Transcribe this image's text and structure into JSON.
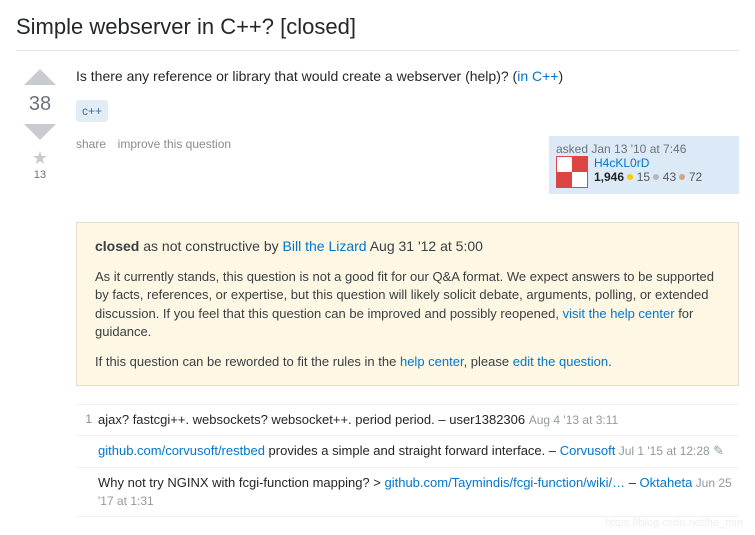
{
  "title": "Simple webserver in C++? [closed]",
  "body_pre": "Is there any reference or library that would create a webserver (help)? (",
  "body_link": "in C++",
  "body_post": ")",
  "tag": "c++",
  "votes": "38",
  "favorites": "13",
  "actions": {
    "share": "share",
    "improve": "improve this question"
  },
  "usercard": {
    "asked": "asked Jan 13 '10 at 7:46",
    "name": "H4cKL0rD",
    "rep": "1,946",
    "gold": "15",
    "silver": "43",
    "bronze": "72"
  },
  "notice": {
    "closed_strong": "closed",
    "closed_mid": " as not constructive by ",
    "closed_by": "Bill the Lizard",
    "closed_time": " Aug 31 '12 at 5:00",
    "p1a": "As it currently stands, this question is not a good fit for our Q&A format. We expect answers to be supported by facts, references, or expertise, but this question will likely solicit debate, arguments, polling, or extended discussion. If you feel that this question can be improved and possibly reopened, ",
    "p1link": "visit the help center",
    "p1b": " for guidance.",
    "p2a": "If this question can be reworded to fit the rules in the ",
    "p2link1": "help center",
    "p2b": ", please ",
    "p2link2": "edit the question",
    "p2c": "."
  },
  "comments": [
    {
      "score": "1",
      "text": "ajax? fastcgi++. websockets? websocket++. period period. – user1382306 ",
      "meta": "Aug 4 '13 at 3:11"
    },
    {
      "score": "",
      "link1": "github.com/corvusoft/restbed",
      "mid": " provides a simple and straight forward interface. – ",
      "user": "Corvusoft",
      "meta": " Jul 1 '15 at 12:28 "
    },
    {
      "score": "",
      "pre": "Why not try NGINX with fcgi-function mapping? > ",
      "link1": "github.com/Taymindis/fcgi-function/wiki/…",
      "mid": " – ",
      "user": "Oktaheta",
      "meta": " Jun 25 '17 at 1:31"
    }
  ],
  "watermark": "https://blog.csdn.net/he_min"
}
